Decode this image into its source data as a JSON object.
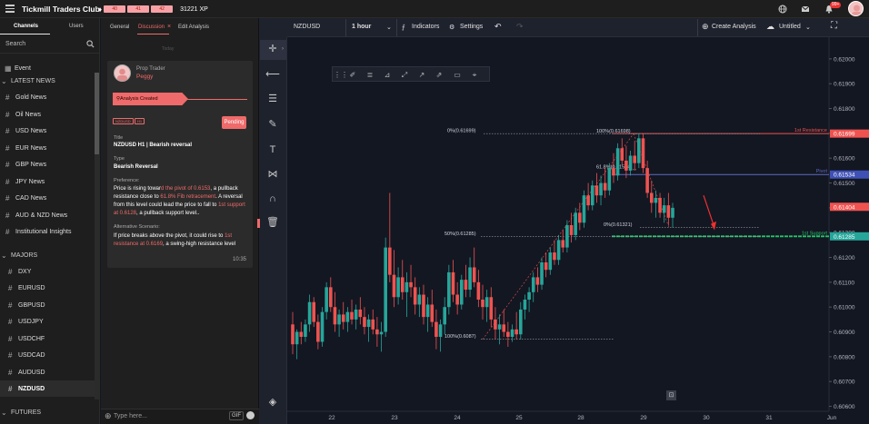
{
  "app": {
    "title": "Tickmill Traders Club",
    "xp": {
      "segments": [
        "40",
        "41",
        "42"
      ],
      "total": "31221 XP"
    },
    "notif_count": "99+"
  },
  "sidebar": {
    "tabs": [
      "Channels",
      "Users"
    ],
    "search_placeholder": "Search",
    "items": [
      {
        "label": "Event",
        "type": "event"
      },
      {
        "label": "LATEST NEWS",
        "type": "section"
      },
      {
        "label": "Gold News",
        "type": "channel"
      },
      {
        "label": "Oil News",
        "type": "channel"
      },
      {
        "label": "USD News",
        "type": "channel"
      },
      {
        "label": "EUR News",
        "type": "channel"
      },
      {
        "label": "GBP News",
        "type": "channel"
      },
      {
        "label": "JPY News",
        "type": "channel"
      },
      {
        "label": "CAD News",
        "type": "channel"
      },
      {
        "label": "AUD & NZD News",
        "type": "channel"
      },
      {
        "label": "Institutional Insights",
        "type": "channel"
      },
      {
        "label": "MAJORS",
        "type": "section"
      },
      {
        "label": "DXY",
        "type": "channel"
      },
      {
        "label": "EURUSD",
        "type": "channel"
      },
      {
        "label": "GBPUSD",
        "type": "channel"
      },
      {
        "label": "USDJPY",
        "type": "channel"
      },
      {
        "label": "USDCHF",
        "type": "channel"
      },
      {
        "label": "USDCAD",
        "type": "channel"
      },
      {
        "label": "AUDUSD",
        "type": "channel"
      },
      {
        "label": "NZDUSD",
        "type": "channel-active"
      },
      {
        "label": "FUTURES",
        "type": "section"
      }
    ]
  },
  "discussion": {
    "tabs": [
      "General",
      "Discussion",
      "Edit Analysis"
    ],
    "close_glyph": "×",
    "date_divider": "Today",
    "card": {
      "role": "Prop Trader",
      "name": "Peggy",
      "banner": "Analysis Created",
      "chips": [
        "NZDUSD",
        "H1"
      ],
      "status": "Pending",
      "title_label": "Title",
      "title": "NZDUSD H1 | Bearish reversal",
      "type_label": "Type",
      "type": "Bearish Reversal",
      "pref_label": "Preference:",
      "pref_parts": [
        "Price is rising towar",
        "d the pivot of 0.6153",
        ", a pullback resistance close to ",
        "61.8% Fib retracement",
        ". A reversal from this level could lead the price to fall to ",
        "1st support at 0.6128",
        ", a pullback support level.."
      ],
      "alt_label": "Alternative Scenario:",
      "alt_parts": [
        "If price breaks above the pivot, it could rise to ",
        "1st resistance at 0.6169",
        ", a swing-high resistance level"
      ],
      "time": "10:35"
    },
    "message_placeholder": "Type here...",
    "gif_label": "GIF"
  },
  "toolbar": {
    "symbol": "NZDUSD",
    "interval": "1 hour",
    "indicators": "Indicators",
    "settings": "Settings",
    "create_analysis": "Create Analysis",
    "layout_name": "Untitled"
  },
  "chart_data": {
    "type": "candlestick",
    "symbol": "NZDUSD",
    "interval": "1 hour",
    "x_tick_labels": [
      "22",
      "23",
      "24",
      "25",
      "28",
      "29",
      "30",
      "31",
      "Jun"
    ],
    "y_tick_labels": [
      "0.62000",
      "0.61900",
      "0.61800",
      "0.61700",
      "0.61600",
      "0.61500",
      "0.61400",
      "0.61300",
      "0.61200",
      "0.61100",
      "0.61000",
      "0.60900",
      "0.60800",
      "0.60700",
      "0.60600"
    ],
    "ylim": [
      0.6058,
      0.6208
    ],
    "price_labels": [
      {
        "value": "0.61699",
        "color": "#ef5350"
      },
      {
        "value": "0.61534",
        "color": "#3f51b5"
      },
      {
        "value": "0.61404",
        "color": "#ef5350"
      },
      {
        "value": "0.61285",
        "color": "#26a69a"
      }
    ],
    "levels": [
      {
        "name": "1st Resistance",
        "value": 0.61699,
        "color": "#ef5350"
      },
      {
        "name": "Pivot",
        "value": 0.61534,
        "color": "#5c6bc0"
      },
      {
        "name": "1st Support",
        "value": 0.61285,
        "color": "#26c26a"
      }
    ],
    "fib_labels": [
      {
        "text": "0%(0.61699)",
        "value": 0.61699
      },
      {
        "text": "100%(0.61698)",
        "value": 0.61698
      },
      {
        "text": "61.8%(0.61554)",
        "value": 0.61554
      },
      {
        "text": "50%(0.61285)",
        "value": 0.61285
      },
      {
        "text": "0%(0.61321)",
        "value": 0.61321
      },
      {
        "text": "100%(0.6087)",
        "value": 0.6087
      }
    ],
    "candles": [
      [
        0.6093,
        0.6098,
        0.6081,
        0.6085
      ],
      [
        0.6085,
        0.6091,
        0.6079,
        0.609
      ],
      [
        0.609,
        0.6094,
        0.6085,
        0.6088
      ],
      [
        0.6088,
        0.6095,
        0.6086,
        0.6093
      ],
      [
        0.6093,
        0.6105,
        0.609,
        0.6102
      ],
      [
        0.6102,
        0.6104,
        0.6092,
        0.6094
      ],
      [
        0.6094,
        0.6097,
        0.6083,
        0.6086
      ],
      [
        0.6086,
        0.61,
        0.6084,
        0.6098
      ],
      [
        0.6098,
        0.611,
        0.6095,
        0.6108
      ],
      [
        0.6108,
        0.6112,
        0.6098,
        0.61
      ],
      [
        0.61,
        0.6106,
        0.609,
        0.6093
      ],
      [
        0.6093,
        0.6099,
        0.6088,
        0.6097
      ],
      [
        0.6097,
        0.6102,
        0.6091,
        0.6094
      ],
      [
        0.6094,
        0.61,
        0.609,
        0.6098
      ],
      [
        0.6098,
        0.6103,
        0.6093,
        0.6095
      ],
      [
        0.6095,
        0.6101,
        0.6091,
        0.6099
      ],
      [
        0.6099,
        0.6104,
        0.6093,
        0.6096
      ],
      [
        0.6096,
        0.61,
        0.6089,
        0.6092
      ],
      [
        0.6092,
        0.6097,
        0.6086,
        0.6095
      ],
      [
        0.6095,
        0.6099,
        0.6089,
        0.6091
      ],
      [
        0.6091,
        0.6096,
        0.6084,
        0.6089
      ],
      [
        0.6089,
        0.6094,
        0.6082,
        0.609
      ],
      [
        0.609,
        0.6128,
        0.6088,
        0.6124
      ],
      [
        0.6124,
        0.6146,
        0.611,
        0.6113
      ],
      [
        0.6113,
        0.6123,
        0.61,
        0.6104
      ],
      [
        0.6104,
        0.6116,
        0.6101,
        0.6112
      ],
      [
        0.6112,
        0.6119,
        0.6103,
        0.6106
      ],
      [
        0.6106,
        0.6114,
        0.6096,
        0.611
      ],
      [
        0.611,
        0.6117,
        0.6104,
        0.6108
      ],
      [
        0.6108,
        0.6112,
        0.6097,
        0.6101
      ],
      [
        0.6101,
        0.6108,
        0.6096,
        0.6105
      ],
      [
        0.6105,
        0.6109,
        0.6093,
        0.6096
      ],
      [
        0.6096,
        0.6104,
        0.609,
        0.6101
      ],
      [
        0.6101,
        0.6107,
        0.6092,
        0.6094
      ],
      [
        0.6094,
        0.6099,
        0.6083,
        0.6088
      ],
      [
        0.6088,
        0.6095,
        0.6082,
        0.6093
      ],
      [
        0.6093,
        0.6104,
        0.6089,
        0.61
      ],
      [
        0.61,
        0.6117,
        0.6097,
        0.6114
      ],
      [
        0.6114,
        0.6119,
        0.6102,
        0.6105
      ],
      [
        0.6105,
        0.611,
        0.6097,
        0.6101
      ],
      [
        0.6101,
        0.6113,
        0.6099,
        0.6111
      ],
      [
        0.6111,
        0.6117,
        0.6104,
        0.6107
      ],
      [
        0.6107,
        0.612,
        0.6104,
        0.6116
      ],
      [
        0.6116,
        0.6124,
        0.6108,
        0.611
      ],
      [
        0.611,
        0.6115,
        0.61,
        0.6103
      ],
      [
        0.6103,
        0.6109,
        0.6095,
        0.61
      ],
      [
        0.61,
        0.6107,
        0.6094,
        0.6104
      ],
      [
        0.6104,
        0.6108,
        0.6092,
        0.6095
      ],
      [
        0.6095,
        0.61,
        0.6087,
        0.6091
      ],
      [
        0.6091,
        0.6097,
        0.6085,
        0.6093
      ],
      [
        0.6093,
        0.6099,
        0.6088,
        0.609
      ],
      [
        0.609,
        0.6094,
        0.6084,
        0.6088
      ],
      [
        0.6088,
        0.6093,
        0.6086,
        0.6091
      ],
      [
        0.6091,
        0.6098,
        0.6087,
        0.6089
      ],
      [
        0.6089,
        0.6102,
        0.6087,
        0.6099
      ],
      [
        0.6099,
        0.6105,
        0.6095,
        0.6103
      ],
      [
        0.6103,
        0.6108,
        0.6098,
        0.6106
      ],
      [
        0.6106,
        0.6114,
        0.6102,
        0.6112
      ],
      [
        0.6112,
        0.6116,
        0.6106,
        0.6109
      ],
      [
        0.6109,
        0.612,
        0.6107,
        0.6118
      ],
      [
        0.6118,
        0.6122,
        0.6112,
        0.6115
      ],
      [
        0.6115,
        0.6124,
        0.6113,
        0.6122
      ],
      [
        0.6122,
        0.6127,
        0.6117,
        0.6119
      ],
      [
        0.6119,
        0.6129,
        0.6117,
        0.6127
      ],
      [
        0.6127,
        0.6131,
        0.6122,
        0.6124
      ],
      [
        0.6124,
        0.6135,
        0.6122,
        0.6133
      ],
      [
        0.6133,
        0.6138,
        0.6126,
        0.6129
      ],
      [
        0.6129,
        0.614,
        0.6127,
        0.6138
      ],
      [
        0.6138,
        0.6142,
        0.6131,
        0.6134
      ],
      [
        0.6134,
        0.6147,
        0.6132,
        0.6145
      ],
      [
        0.6145,
        0.615,
        0.6139,
        0.6141
      ],
      [
        0.6141,
        0.6151,
        0.6139,
        0.6149
      ],
      [
        0.6149,
        0.6154,
        0.6142,
        0.6145
      ],
      [
        0.6145,
        0.6153,
        0.6141,
        0.615
      ],
      [
        0.615,
        0.6156,
        0.6144,
        0.6147
      ],
      [
        0.6147,
        0.6158,
        0.6145,
        0.6156
      ],
      [
        0.6156,
        0.6162,
        0.615,
        0.6153
      ],
      [
        0.6153,
        0.6166,
        0.6151,
        0.6164
      ],
      [
        0.6164,
        0.6168,
        0.6157,
        0.6159
      ],
      [
        0.6159,
        0.6165,
        0.6152,
        0.6155
      ],
      [
        0.6155,
        0.6163,
        0.6153,
        0.6161
      ],
      [
        0.6161,
        0.6167,
        0.6155,
        0.6158
      ],
      [
        0.6158,
        0.617,
        0.6156,
        0.6168
      ],
      [
        0.6168,
        0.617,
        0.6154,
        0.6156
      ],
      [
        0.6156,
        0.6159,
        0.6144,
        0.6146
      ],
      [
        0.6146,
        0.6151,
        0.6138,
        0.6142
      ],
      [
        0.6142,
        0.6147,
        0.6136,
        0.6144
      ],
      [
        0.6144,
        0.6146,
        0.6136,
        0.6138
      ],
      [
        0.6138,
        0.6144,
        0.6134,
        0.6141
      ],
      [
        0.6141,
        0.6146,
        0.6133,
        0.6136
      ],
      [
        0.6136,
        0.6142,
        0.6132,
        0.614
      ]
    ]
  }
}
